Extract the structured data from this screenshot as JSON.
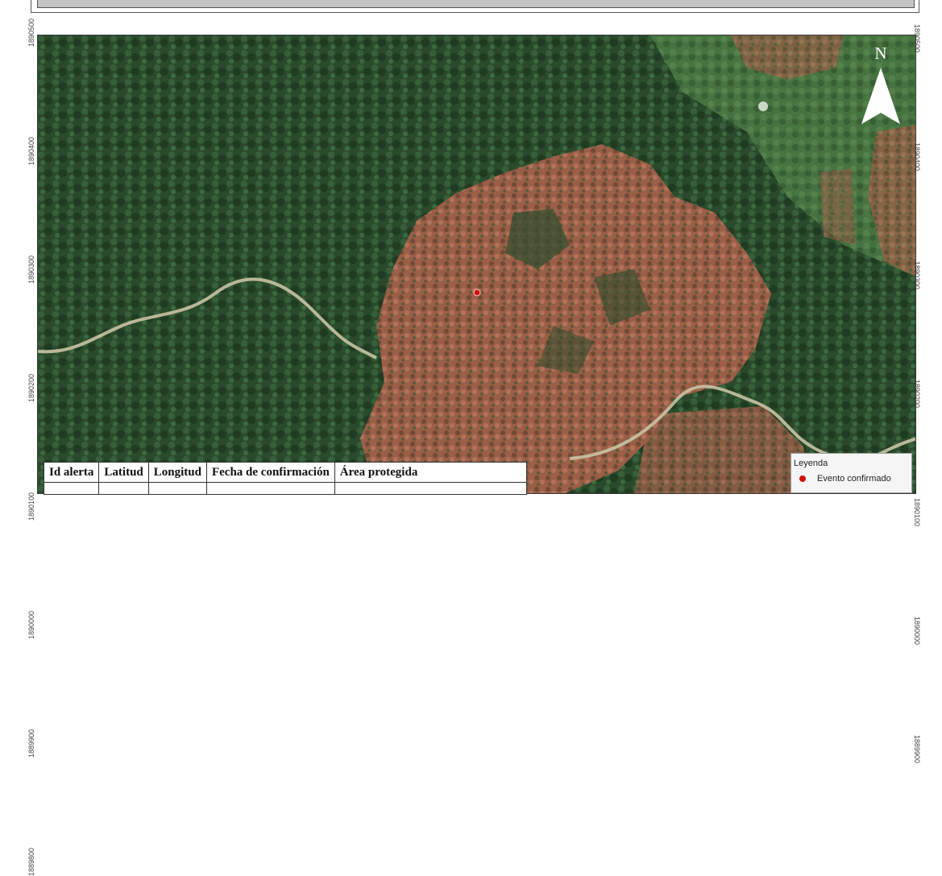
{
  "map": {
    "title": "",
    "coords_left": [
      "1890500",
      "1890400",
      "1890300",
      "1890200",
      "1890100",
      "1890000",
      "1889900",
      "1889800"
    ],
    "coords_right": [
      "1890500",
      "1890400",
      "1890300",
      "1890200",
      "1890100",
      "1890000",
      "1889900"
    ],
    "north_label": "N",
    "event_point_color": "#d01010"
  },
  "table": {
    "headers": [
      "Id alerta",
      "Latitud",
      "Longitud",
      "Fecha de confirmación",
      "Área protegida"
    ]
  },
  "legend": {
    "title": "Leyenda",
    "items": [
      {
        "label": "Evento confirmado",
        "color": "#d01010"
      }
    ]
  }
}
